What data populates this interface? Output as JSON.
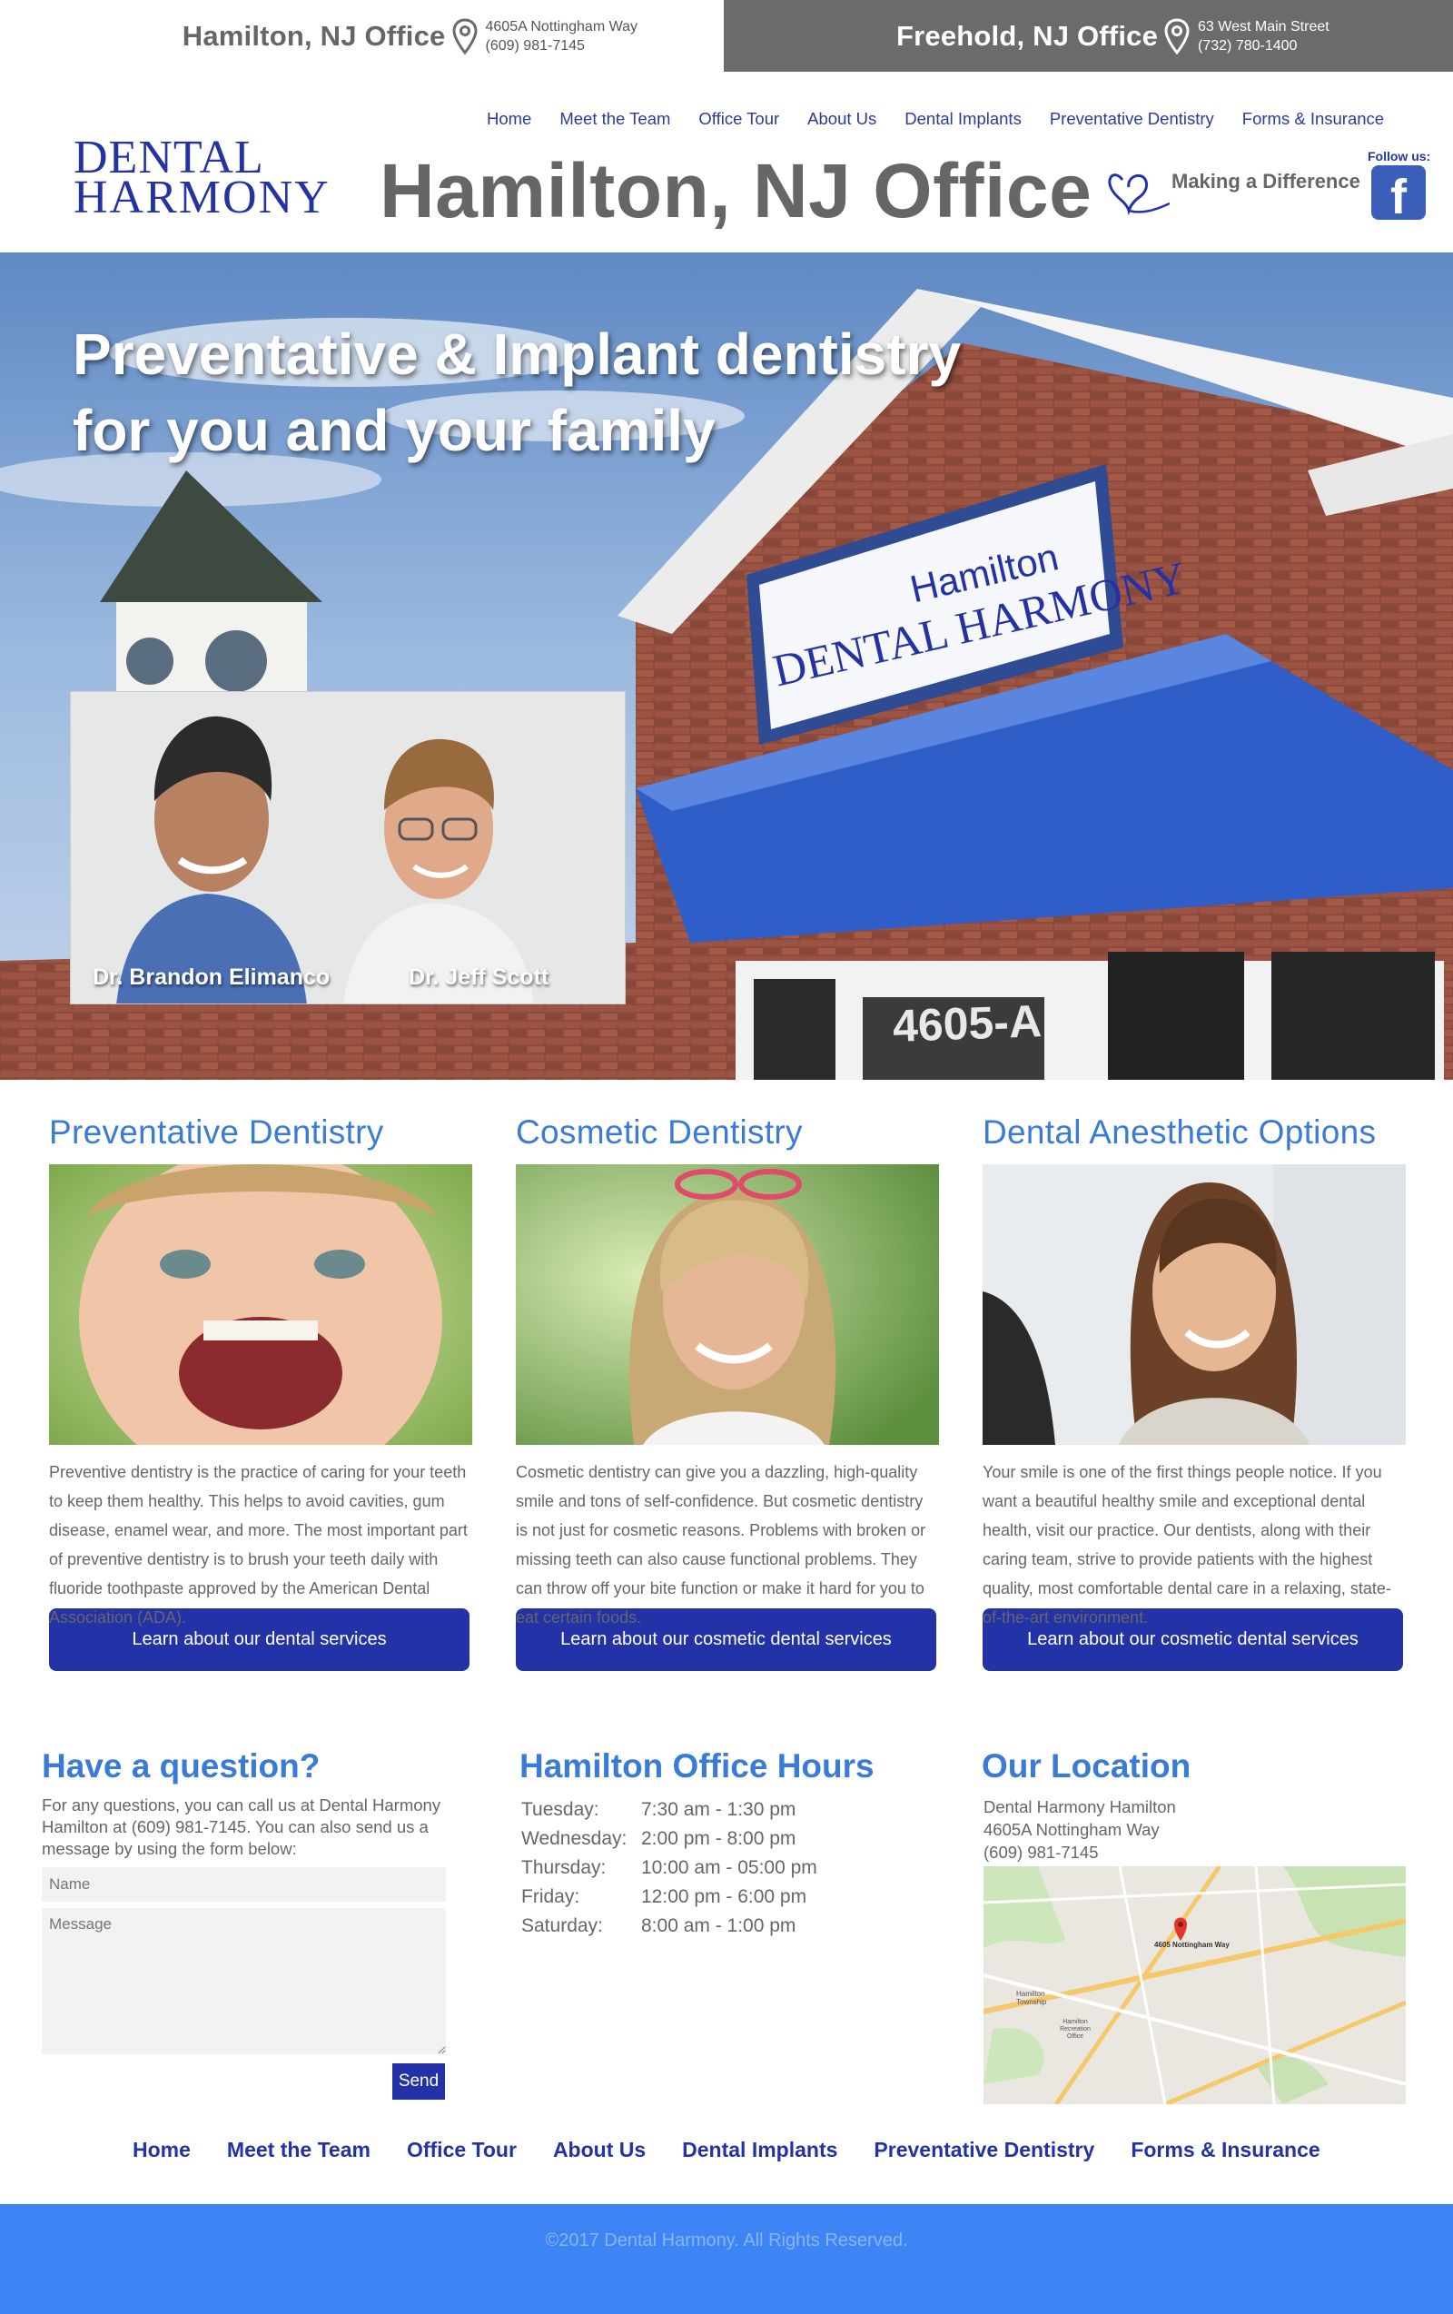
{
  "offices": {
    "hamilton": {
      "name": "Hamilton, NJ Office",
      "address": "4605A Nottingham Way",
      "phone": "(609) 981-7145"
    },
    "freehold": {
      "name": "Freehold, NJ Office",
      "address": "63 West Main Street",
      "phone": "(732) 780-1400"
    }
  },
  "nav": [
    "Home",
    "Meet the Team",
    "Office Tour",
    "About Us",
    "Dental Implants",
    "Preventative Dentistry",
    "Forms & Insurance"
  ],
  "header": {
    "logo_line1": "Dental",
    "logo_line2": "Harmony",
    "page_title": "Hamilton, NJ Office",
    "tagline": "Making a Difference",
    "follow": "Follow us:",
    "facebook_icon": "facebook-icon"
  },
  "hero": {
    "title_line1": "Preventative & Implant dentistry",
    "title_line2": "for you and your family",
    "sign_small": "Hamilton",
    "sign_big": "Dental Harmony",
    "building_number": "4605-A",
    "doctor1": "Dr. Brandon Elimanco",
    "doctor2": "Dr. Jeff Scott"
  },
  "services": [
    {
      "title": "Preventative Dentistry",
      "text": "Preventive dentistry is the practice of caring for your teeth to keep them healthy. This helps to avoid cavities, gum disease, enamel wear, and more. The most important part of preventive dentistry is to brush your teeth daily with fluoride toothpaste approved by the American Dental Association (ADA).",
      "button": "Learn about our dental services"
    },
    {
      "title": "Cosmetic Dentistry",
      "text": "Cosmetic dentistry can give you a dazzling, high-quality smile and tons of self-confidence. But cosmetic dentistry is not just for cosmetic reasons. Problems with broken or missing teeth can also cause functional problems. They can throw off your bite function or make it hard for you to eat certain foods.",
      "button": "Learn about our cosmetic dental services"
    },
    {
      "title": "Dental Anesthetic Options",
      "text": "Your smile is one of the first things people notice. If you want a beautiful healthy smile and exceptional dental health, visit our practice. Our dentists, along with their caring team, strive to provide patients with the highest quality, most comfortable dental care in a relaxing, state-of-the-art environment.",
      "button": "Learn about our cosmetic dental services"
    }
  ],
  "question": {
    "title": "Have a question?",
    "text": "For any questions, you can call us at Dental Harmony Hamilton at (609) 981-7145. You can also send us a message by using the form below:",
    "name_placeholder": "Name",
    "message_placeholder": "Message",
    "send": "Send"
  },
  "hours": {
    "title": "Hamilton Office Hours",
    "rows": [
      {
        "day": "Tuesday:",
        "time": "7:30 am - 1:30 pm"
      },
      {
        "day": "Wednesday:",
        "time": "2:00 pm - 8:00 pm"
      },
      {
        "day": "Thursday:",
        "time": "10:00 am - 05:00 pm"
      },
      {
        "day": "Friday:",
        "time": "12:00 pm - 6:00 pm"
      },
      {
        "day": "Saturday:",
        "time": "8:00 am - 1:00 pm"
      }
    ]
  },
  "location": {
    "title": "Our Location",
    "line1": "Dental Harmony Hamilton",
    "line2": "4605A Nottingham Way",
    "line3": "(609) 981-7145",
    "map_pin_label": "4605 Nottingham Way",
    "map_label_1": "Hamilton Township",
    "map_label_2": "Hamilton Recreation Office"
  },
  "footer": {
    "copyright": "©2017 Dental Harmony. All Rights Reserved."
  },
  "colors": {
    "brand_blue": "#2432a8",
    "heading_blue": "#3a7bd5",
    "footer_blue": "#3d84f5",
    "gray_bar": "#6b6b6b"
  }
}
